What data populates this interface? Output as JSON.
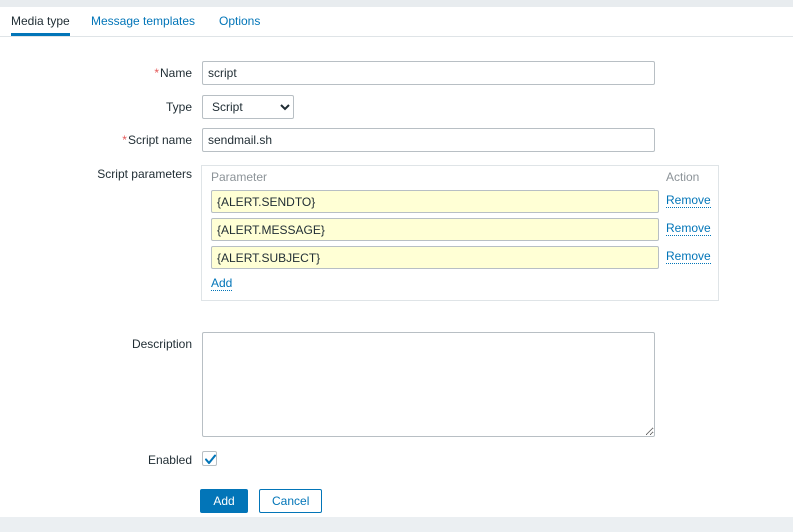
{
  "tabs": [
    {
      "label": "Media type",
      "active": true
    },
    {
      "label": "Message templates",
      "active": false
    },
    {
      "label": "Options",
      "active": false
    }
  ],
  "form": {
    "name": {
      "label": "Name",
      "required": true,
      "value": "script",
      "placeholder": ""
    },
    "type": {
      "label": "Type",
      "required": false,
      "value": "Script",
      "options": [
        "Script"
      ]
    },
    "script_name": {
      "label": "Script name",
      "required": true,
      "value": "sendmail.sh",
      "placeholder": ""
    },
    "script_parameters": {
      "label": "Script parameters",
      "columns": [
        "Parameter",
        "Action"
      ],
      "rows": [
        {
          "value": "{ALERT.SENDTO}",
          "action": "Remove"
        },
        {
          "value": "{ALERT.MESSAGE}",
          "action": "Remove"
        },
        {
          "value": "{ALERT.SUBJECT}",
          "action": "Remove"
        }
      ],
      "add_label": "Add"
    },
    "description": {
      "label": "Description",
      "value": "",
      "placeholder": ""
    },
    "enabled": {
      "label": "Enabled",
      "checked": true
    }
  },
  "footer": {
    "submit_label": "Add",
    "cancel_label": "Cancel"
  },
  "colors": {
    "accent": "#0275b8",
    "required_marker": "#e45959",
    "param_field_bg": "#ffffd5",
    "page_bg": "#ebeff2",
    "border": "#b8bfc4"
  }
}
